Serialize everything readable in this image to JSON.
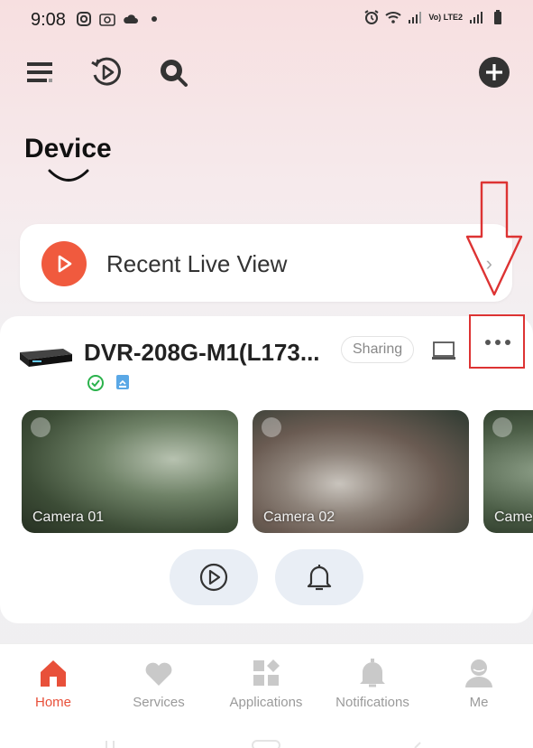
{
  "status_bar": {
    "time": "9:08",
    "network": "Vo) LTE2"
  },
  "toolbar": {
    "icons": [
      "menu-icon",
      "playback-icon",
      "search-icon",
      "add-icon"
    ]
  },
  "page": {
    "title": "Device"
  },
  "recent_live_view": {
    "label": "Recent Live View"
  },
  "device": {
    "name": "DVR-208G-M1(L173...",
    "sharing_label": "Sharing",
    "cameras": [
      {
        "label": "Camera 01"
      },
      {
        "label": "Camera 02"
      },
      {
        "label": "Came"
      }
    ]
  },
  "bottom_nav": {
    "items": [
      {
        "label": "Home",
        "icon": "home-icon",
        "active": true
      },
      {
        "label": "Services",
        "icon": "heart-icon",
        "active": false
      },
      {
        "label": "Applications",
        "icon": "grid-icon",
        "active": false
      },
      {
        "label": "Notifications",
        "icon": "bell-icon",
        "active": false
      },
      {
        "label": "Me",
        "icon": "person-icon",
        "active": false
      }
    ]
  },
  "colors": {
    "accent": "#e8503a",
    "annotation_red": "#dd3333"
  }
}
